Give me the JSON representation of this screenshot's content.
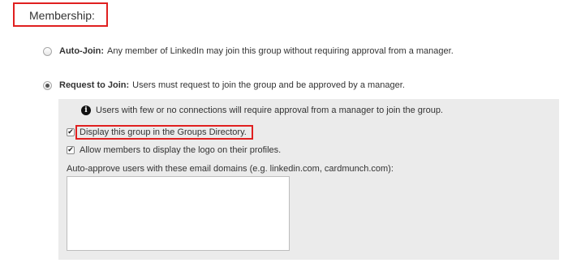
{
  "section": {
    "title": "Membership:"
  },
  "options": {
    "auto_join": {
      "label": "Auto-Join:",
      "description": "Any member of LinkedIn may join this group without requiring approval from a manager.",
      "selected": false
    },
    "request_to_join": {
      "label": "Request to Join:",
      "description": "Users must request to join the group and be approved by a manager.",
      "selected": true
    }
  },
  "panel": {
    "notice_icon": "info-icon",
    "notice": "Users with few or no connections will require approval from a manager to join the group.",
    "directory_checkbox": {
      "label": "Display this group in the Groups Directory.",
      "checked": true
    },
    "logo_checkbox": {
      "label": "Allow members to display the logo on their profiles.",
      "checked": true
    },
    "domains_label": "Auto-approve users with these email domains (e.g. linkedin.com, cardmunch.com):",
    "domains_value": ""
  },
  "colors": {
    "highlight": "#e02020",
    "panel_bg": "#ebebeb"
  }
}
